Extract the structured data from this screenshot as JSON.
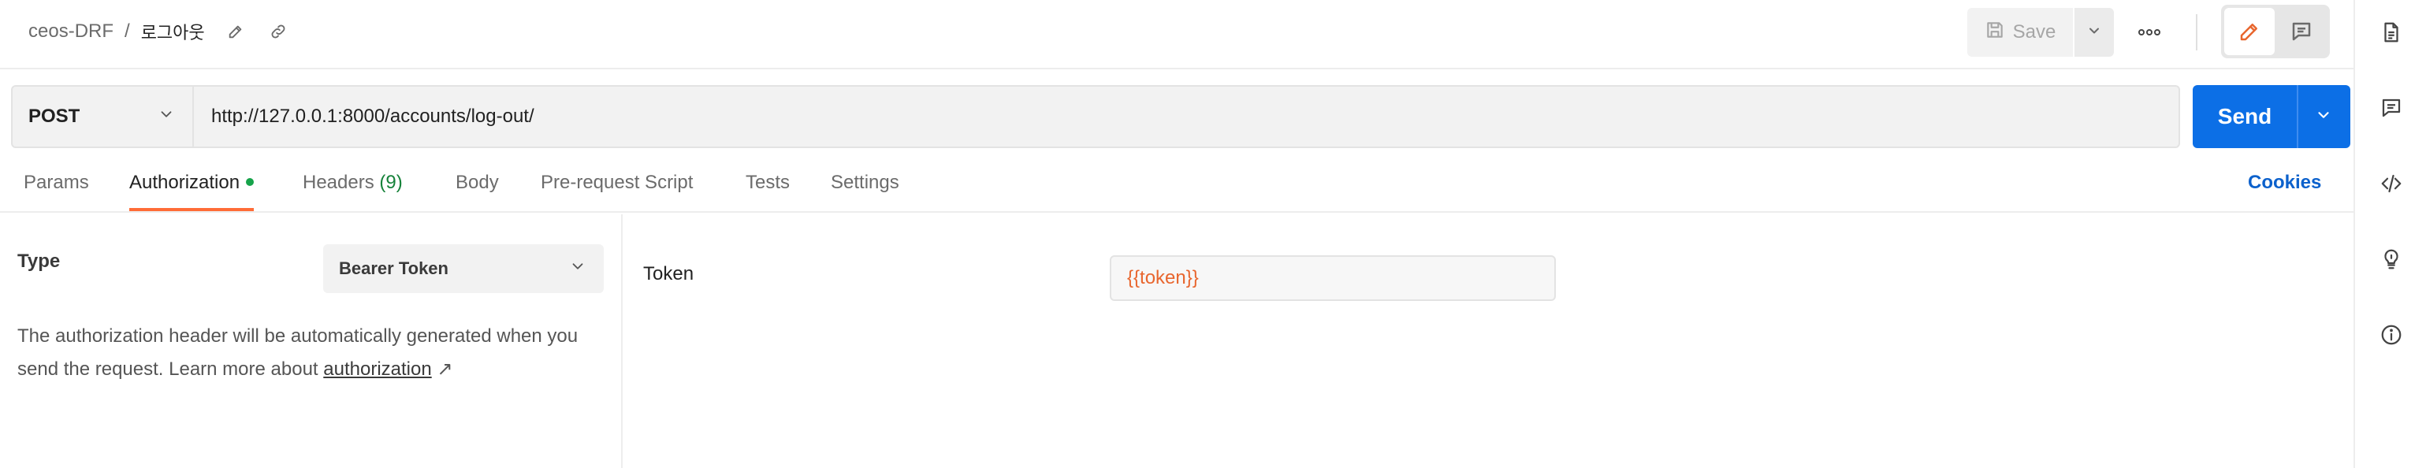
{
  "breadcrumb": {
    "collection": "ceos-DRF",
    "separator": "/",
    "request_name": "로그아웃"
  },
  "toolbar": {
    "save_label": "Save"
  },
  "request": {
    "method": "POST",
    "url": "http://127.0.0.1:8000/accounts/log-out/",
    "send_label": "Send"
  },
  "tabs": {
    "params": "Params",
    "authorization": "Authorization",
    "headers": "Headers",
    "headers_count": "(9)",
    "body": "Body",
    "prerequest": "Pre-request Script",
    "tests": "Tests",
    "settings": "Settings",
    "cookies": "Cookies"
  },
  "auth": {
    "type_label": "Type",
    "type_value": "Bearer Token",
    "description": "The authorization header will be automatically generated when you send the request. Learn more about",
    "link_text": "authorization",
    "link_arrow": "↗",
    "token_label": "Token",
    "token_value": "{{token}}"
  },
  "colors": {
    "accent": "#ff6c37",
    "primary": "#0c6fe6",
    "success": "#16a34a",
    "variable": "#e8662e"
  },
  "icons": [
    "edit-icon",
    "link-icon",
    "save-icon",
    "chevron-down-icon",
    "more-icon",
    "pencil-icon",
    "comment-icon",
    "document-icon",
    "code-icon",
    "lightbulb-icon",
    "info-icon"
  ]
}
